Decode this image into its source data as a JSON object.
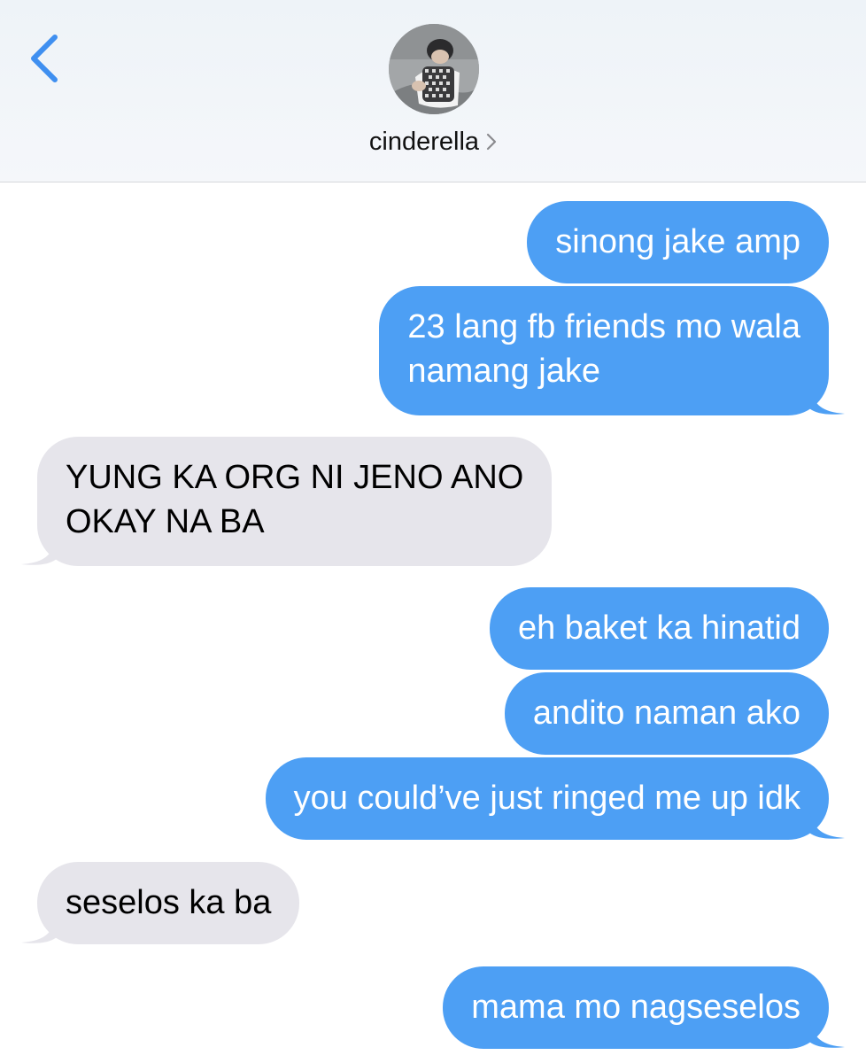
{
  "header": {
    "contact_name": "cinderella",
    "avatar_icon": "profile-photo",
    "back_icon": "chevron-left-icon",
    "info_icon": "chevron-right-icon"
  },
  "colors": {
    "accent": "#3f8ff0",
    "sent_bubble": "#4d9ff4",
    "received_bubble": "#e6e5eb",
    "header_bg": "#f1f4f8"
  },
  "messages": [
    {
      "side": "sent",
      "text": "sinong jake amp"
    },
    {
      "side": "sent",
      "line1": "23 lang fb friends mo wala",
      "line2": "namang jake"
    },
    {
      "side": "received",
      "line1": "YUNG KA ORG NI JENO ANO",
      "line2": "OKAY NA BA"
    },
    {
      "side": "sent",
      "text": "eh baket ka hinatid"
    },
    {
      "side": "sent",
      "text": "andito naman ako"
    },
    {
      "side": "sent",
      "text": "you could’ve just ringed me up idk"
    },
    {
      "side": "received",
      "text": "seselos ka ba"
    },
    {
      "side": "sent",
      "text": "mama mo nagseselos"
    }
  ]
}
